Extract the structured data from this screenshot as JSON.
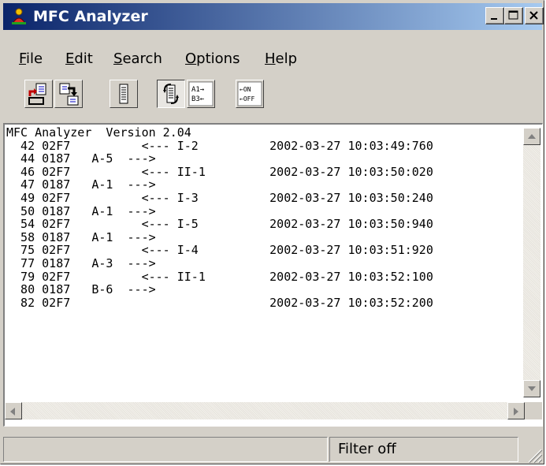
{
  "window": {
    "title": "MFC Analyzer",
    "title_bar_colors": [
      "#0a246a",
      "#a6caf0"
    ]
  },
  "menu": [
    {
      "label": "File",
      "mnemonic": "F",
      "rest": "ile"
    },
    {
      "label": "Edit",
      "mnemonic": "E",
      "rest": "dit"
    },
    {
      "label": "Search",
      "mnemonic": "S",
      "rest": "earch"
    },
    {
      "label": "Options",
      "mnemonic": "O",
      "rest": "ptions"
    },
    {
      "label": "Help",
      "mnemonic": "H",
      "rest": "elp"
    }
  ],
  "toolbar": {
    "buttons": [
      {
        "name": "open-file-button",
        "icon": "open-document-icon",
        "pressed": false
      },
      {
        "name": "save-file-button",
        "icon": "save-document-icon",
        "pressed": false
      },
      {
        "name": "list-view-button",
        "icon": "list-icon",
        "pressed": false
      },
      {
        "name": "auto-scroll-button",
        "icon": "refresh-icon",
        "pressed": true
      },
      {
        "name": "address-toggle-button",
        "icon": "address-arrows-icon",
        "pressed": false,
        "lines": [
          "A1→",
          "B3←"
        ]
      },
      {
        "name": "on-off-toggle-button",
        "icon": "on-off-arrows-icon",
        "pressed": false,
        "lines": [
          "←ON",
          "←OFF"
        ]
      }
    ]
  },
  "log": {
    "lines": [
      "MFC Analyzer  Version 2.04",
      "  42 02F7          <--- I-2          2002-03-27 10:03:49:760",
      "  44 0187   A-5  --->",
      "  46 02F7          <--- II-1         2002-03-27 10:03:50:020",
      "  47 0187   A-1  --->",
      "  49 02F7          <--- I-3          2002-03-27 10:03:50:240",
      "  50 0187   A-1  --->",
      "  54 02F7          <--- I-5          2002-03-27 10:03:50:940",
      "  58 0187   A-1  --->",
      "  75 02F7          <--- I-4          2002-03-27 10:03:51:920",
      "  77 0187   A-3  --->",
      "  79 02F7          <--- II-1         2002-03-27 10:03:52:100",
      "  80 0187   B-6  --->",
      "  82 02F7                            2002-03-27 10:03:52:200"
    ]
  },
  "status": {
    "left": "",
    "filter": "Filter off"
  }
}
